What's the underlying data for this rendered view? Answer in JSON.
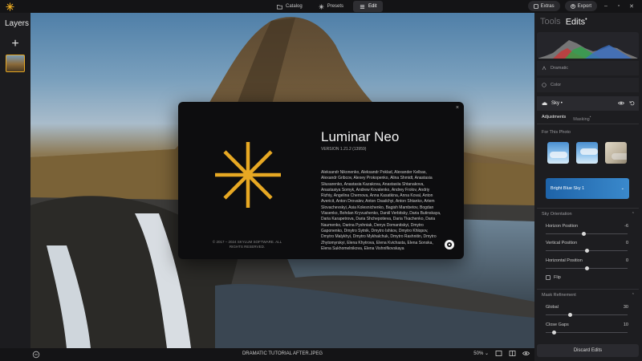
{
  "colors": {
    "accent": "#e7a823",
    "sky_selected": "#2a7ac0",
    "panel_bg": "#1d1d20"
  },
  "topbar": {
    "nav": [
      {
        "label": "Catalog",
        "icon": "folder-icon"
      },
      {
        "label": "Presets",
        "icon": "sparkle-icon"
      },
      {
        "label": "Edit",
        "icon": "sliders-icon"
      }
    ],
    "extras_label": "Extras",
    "export_label": "Export"
  },
  "layers": {
    "title": "Layers",
    "add_label": "+"
  },
  "about": {
    "close_label": "×",
    "title": "Luminar Neo",
    "version": "VERSION 1.21.2 (13959)",
    "credits": "Aleksandr Nikonenko, Aleksandr Poklad, Alexander Kelbas, Alexandr Gribcov, Alexey Prokopenko, Alina Shmidt, Anastasia Sliusarenko, Anastasia Kazakova, Anastasiia Shtanakova, Anastasiya Somyk, Andrew Kovalenko, Andrey Frolov, Andriy Rizhiy, Angelina Chernova, Anna Kasatkina, Anna Koval, Anton Avericit, Anton Drovalev, Anton Osadchyi, Anton Shtanko, Artem Slovachevskyi, Asia Kolesnichenko, Bagish Mambetov, Bogdan Vlasenko, Bohdan Kryvushenko, Daniil Verbitsky, Daria Butinskaya, Daria Karapetrova, Daria Shchepotieva, Daria Tkachenko, Daria Naumenko, Darina Pyshniak, Denys Domanitskyi, Dmytro Gaponenko, Dmytro Sytnik, Dmytro Ishkov, Dmytro Khlopov, Dmytro Malykhyi, Dmytro Mykhalchuk, Dmytro Rashnitin, Dmytro Zhytomyrskyi, Elena Khytrova, Elena Kvichasta, Elena Sonska, Elena Sukhomelnikova, Elena Vishnifkovskaya",
    "copyright": "© 2017 – 2024 SKYLUM SOFTWARE. ALL RIGHTS RESERVED."
  },
  "bottombar": {
    "filename": "DRAMATIC TUTORIAL AFTER.JPEG",
    "zoom": "50%",
    "zoom_chevron": "⌄"
  },
  "editpanel": {
    "tab_tools": "Tools",
    "tab_edits": "Edits",
    "edits_dot": "•",
    "tools": [
      {
        "label": "Dramatic",
        "icon": "dramatic-icon"
      },
      {
        "label": "Color",
        "icon": "color-icon"
      }
    ],
    "sky": {
      "title": "Sky",
      "dot": "•",
      "subtab_adjustments": "Adjustments",
      "subtab_masking": "Masking",
      "masking_dot": "•",
      "for_this_photo": "For This Photo",
      "selected_sky": "Bright Blue Sky 1",
      "selected_chevron": "⌄",
      "orientation": {
        "title": "Sky Orientation",
        "chevron": "⌃",
        "sliders": [
          {
            "label": "Horizon Position",
            "value": "-6",
            "fraction": 0.47
          },
          {
            "label": "Vertical Position",
            "value": "0",
            "fraction": 0.5
          },
          {
            "label": "Horizontal Position",
            "value": "0",
            "fraction": 0.5
          }
        ],
        "flip_label": "Flip"
      },
      "mask_refinement": {
        "title": "Mask Refinement",
        "chevron": "⌃",
        "sliders": [
          {
            "label": "Global",
            "value": "30",
            "fraction": 0.3
          },
          {
            "label": "Close Gaps",
            "value": "10",
            "fraction": 0.1
          }
        ]
      }
    },
    "discard_label": "Discard Edits"
  }
}
